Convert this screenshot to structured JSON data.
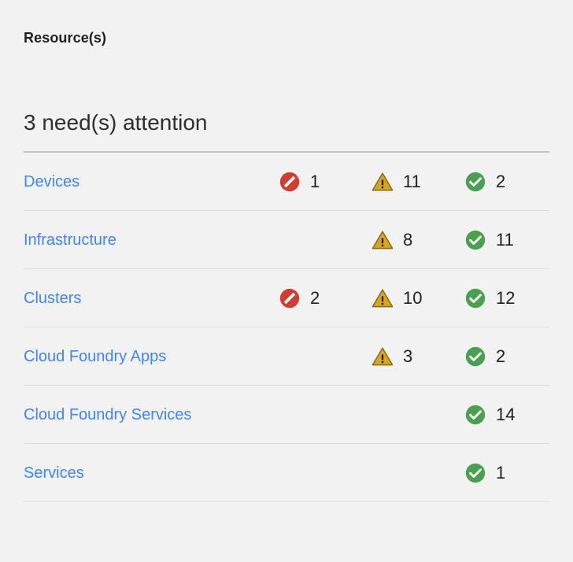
{
  "panel": {
    "title": "Resource(s)",
    "attention_heading": "3 need(s) attention"
  },
  "colors": {
    "background": "#f2f2f2",
    "link": "#4285f4",
    "critical": "#d03d33",
    "warning": "#d6a623",
    "ok": "#4b9f51",
    "head_rule": "#c4c4c4",
    "row_rule": "#dedede",
    "text": "#202020"
  },
  "icons": {
    "critical": "no-entry-icon",
    "warning": "warning-triangle-icon",
    "ok": "check-circle-icon"
  },
  "table": {
    "rows": [
      {
        "label": "Devices",
        "critical": "1",
        "warning": "11",
        "ok": "2",
        "has_critical": true,
        "has_warning": true,
        "has_ok": true
      },
      {
        "label": "Infrastructure",
        "critical": "",
        "warning": "8",
        "ok": "11",
        "has_critical": false,
        "has_warning": true,
        "has_ok": true
      },
      {
        "label": "Clusters",
        "critical": "2",
        "warning": "10",
        "ok": "12",
        "has_critical": true,
        "has_warning": true,
        "has_ok": true
      },
      {
        "label": "Cloud Foundry Apps",
        "critical": "",
        "warning": "3",
        "ok": "2",
        "has_critical": false,
        "has_warning": true,
        "has_ok": true
      },
      {
        "label": "Cloud Foundry Services",
        "critical": "",
        "warning": "",
        "ok": "14",
        "has_critical": false,
        "has_warning": false,
        "has_ok": true
      },
      {
        "label": "Services",
        "critical": "",
        "warning": "",
        "ok": "1",
        "has_critical": false,
        "has_warning": false,
        "has_ok": true
      }
    ]
  }
}
